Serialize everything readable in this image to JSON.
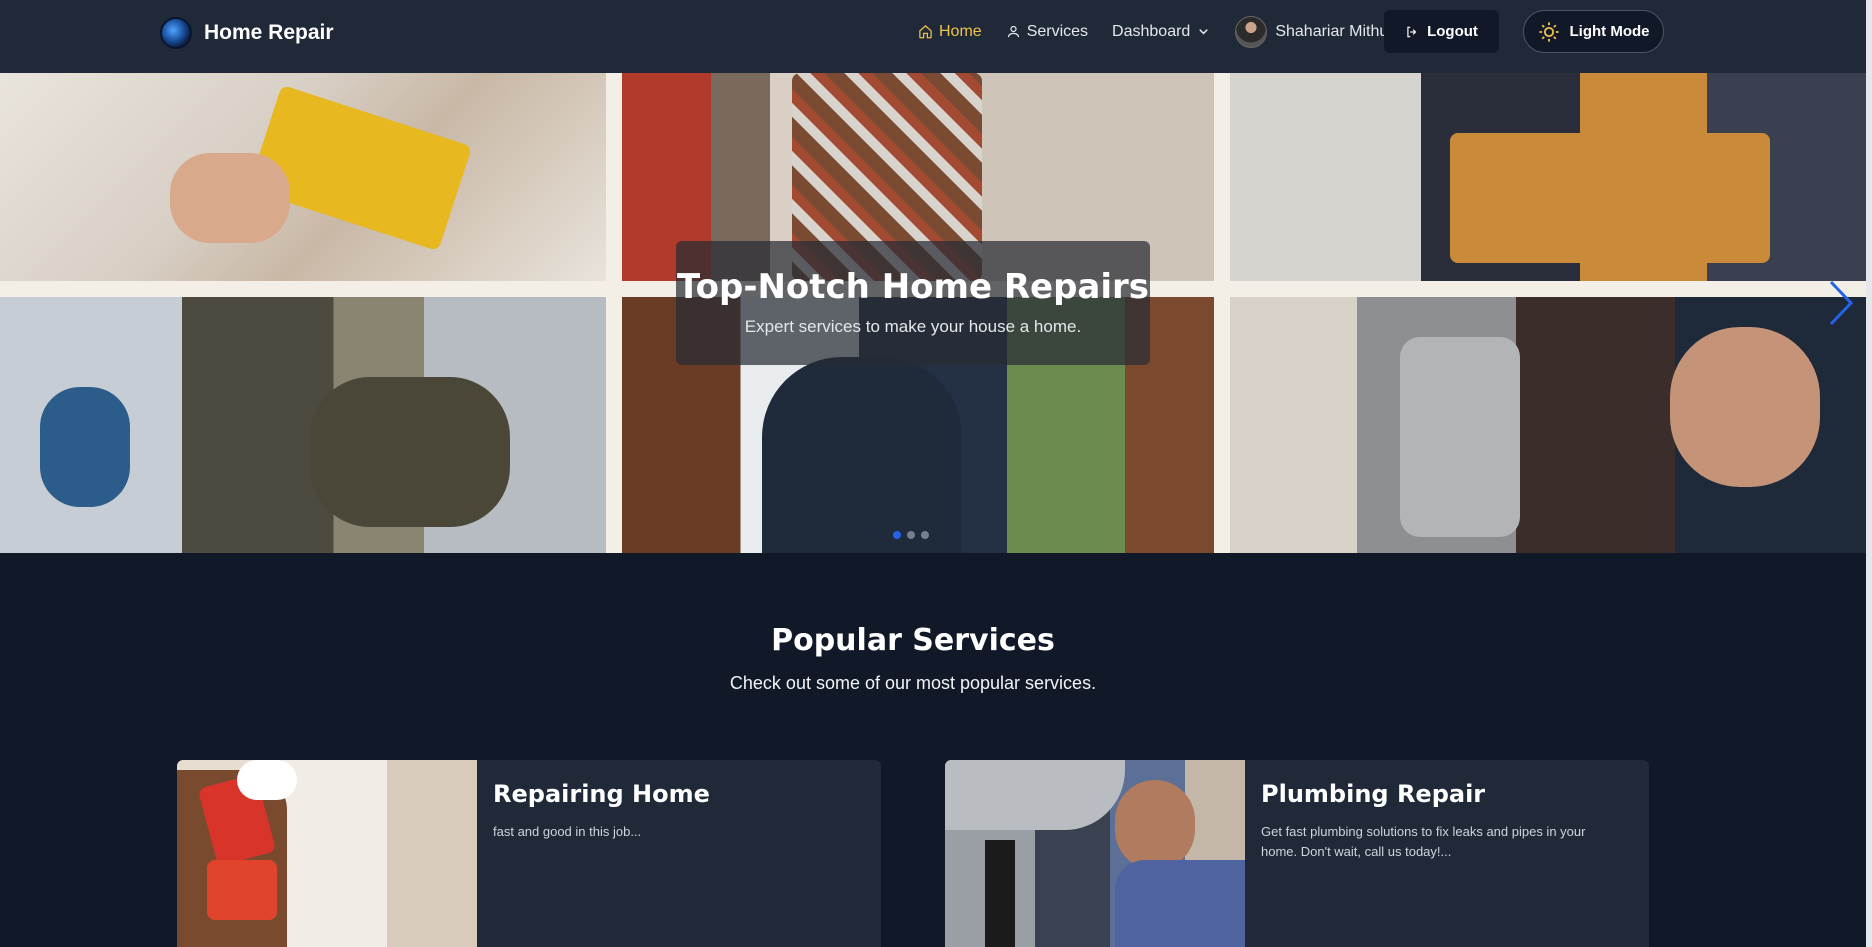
{
  "navbar": {
    "brand": "Home Repair",
    "logo_icon": "globe-logo-icon",
    "links": {
      "home": "Home",
      "services": "Services",
      "dashboard": "Dashboard"
    },
    "user_name": "Shahariar Mithu",
    "logout_label": "Logout",
    "theme_toggle_label": "Light Mode",
    "active_color": "#f0c24a"
  },
  "hero": {
    "title": "Top-Notch Home Repairs",
    "subtitle": "Expert services to make your house a home.",
    "slide_count": 3,
    "active_slide": 1,
    "next_arrow_color": "#2563eb"
  },
  "popular": {
    "title": "Popular Services",
    "subtitle": "Check out some of our most popular services.",
    "cards": [
      {
        "title": "Repairing Home",
        "description": "fast and good in this job..."
      },
      {
        "title": "Plumbing Repair",
        "description": "Get fast plumbing solutions to fix leaks and pipes in your home. Don't wait, call us today!..."
      }
    ]
  },
  "colors": {
    "page_bg": "#111827",
    "nav_bg": "#1f2937",
    "card_bg": "#1f2937"
  }
}
